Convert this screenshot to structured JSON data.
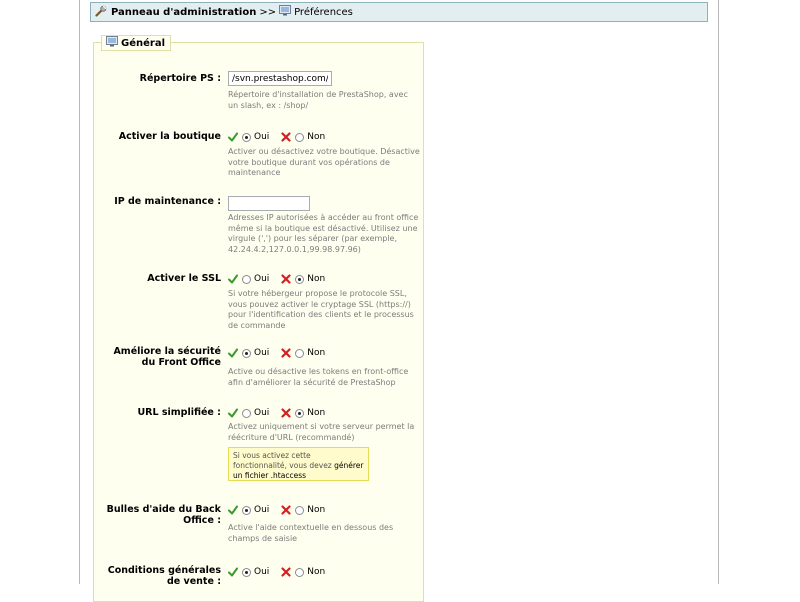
{
  "breadcrumb": {
    "admin_label": "Panneau d'administration",
    "separator": ">>",
    "current_label": "Préférences"
  },
  "legend": {
    "label": "Général"
  },
  "fields": {
    "ps_dir": {
      "label": "Répertoire PS :",
      "value": "/svn.prestashop.com/",
      "hint": "Répertoire d'installation de PrestaShop, avec un slash, ex : /shop/"
    },
    "shop_enable": {
      "label": "Activer la boutique",
      "yes": "Oui",
      "no": "Non",
      "selected": "yes",
      "hint": "Activer ou désactivez votre boutique. Désactive votre boutique durant vos opérations de maintenance"
    },
    "maintenance_ip": {
      "label": "IP de maintenance :",
      "value": "",
      "hint": "Adresses IP autorisées à accéder au front office même si la boutique est désactivé. Utilisez une virgule (',') pour les séparer (par exemple, 42.24.4.2,127.0.0.1,99.98.97.96)"
    },
    "ssl": {
      "label": "Activer le SSL",
      "yes": "Oui",
      "no": "Non",
      "selected": "no",
      "hint": "Si votre hébergeur propose le protocole SSL, vous pouvez activer le cryptage SSL (https://) pour l'identification des clients et le processus de commande"
    },
    "token": {
      "label": "Améliore la sécurité du Front Office",
      "yes": "Oui",
      "no": "Non",
      "selected": "yes",
      "hint": "Active ou désactive les tokens en front-office afin d'améliorer la sécurité de PrestaShop"
    },
    "rewrite": {
      "label": "URL simplifiée :",
      "yes": "Oui",
      "no": "Non",
      "selected": "no",
      "hint": "Activez uniquement si votre serveur permet la réécriture d'URL (recommandé)",
      "warning_text": "Si vous activez cette fonctionnalité, vous devez",
      "warning_link": "générer un fichier .htaccess"
    },
    "help_boxes": {
      "label": "Bulles d'aide du Back Office :",
      "yes": "Oui",
      "no": "Non",
      "selected": "yes",
      "hint": "Active l'aide contextuelle en dessous des champs de saisie"
    },
    "conditions": {
      "label": "Conditions générales de vente :",
      "yes": "Oui",
      "no": "Non",
      "selected": "yes"
    }
  },
  "icons": {
    "admin": "wrench-icon",
    "preferences": "monitor-icon",
    "yes": "check-icon",
    "no": "cross-icon"
  },
  "colors": {
    "breadcrumb_bg": "#e3eef1",
    "fieldset_bg": "#fffff0",
    "check": "#3a9b2c",
    "cross": "#d62020",
    "warning_bg": "#fffbcc"
  }
}
